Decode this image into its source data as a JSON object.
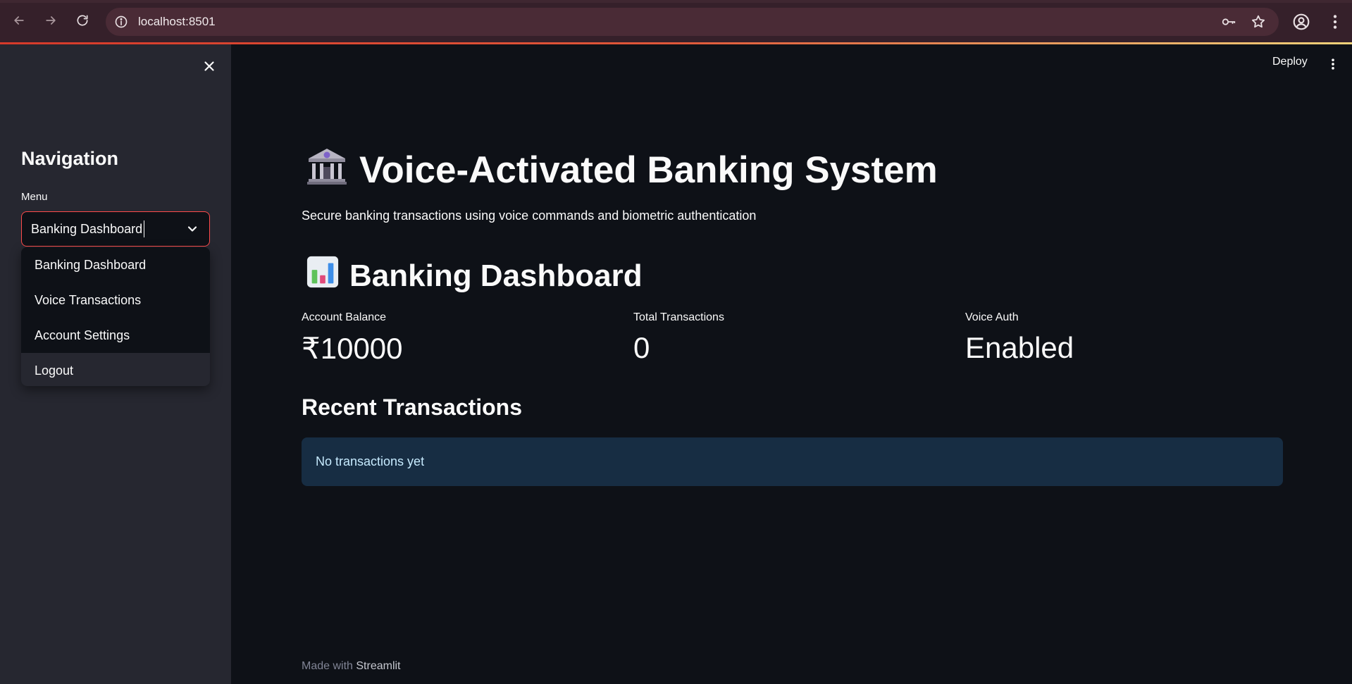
{
  "browser": {
    "url": "localhost:8501"
  },
  "sidebar": {
    "title": "Navigation",
    "menu_label": "Menu",
    "select_value": "Banking Dashboard",
    "options": [
      {
        "label": "Banking Dashboard"
      },
      {
        "label": "Voice Transactions"
      },
      {
        "label": "Account Settings"
      },
      {
        "label": "Logout"
      }
    ]
  },
  "header": {
    "deploy_label": "Deploy"
  },
  "main": {
    "title": "Voice-Activated Banking System",
    "title_icon": "bank-icon",
    "subtitle": "Secure banking transactions using voice commands and biometric authentication",
    "section_title": "Banking Dashboard",
    "section_icon": "bar-chart-icon",
    "metrics": [
      {
        "label": "Account Balance",
        "value": "₹10000"
      },
      {
        "label": "Total Transactions",
        "value": "0"
      },
      {
        "label": "Voice Auth",
        "value": "Enabled"
      }
    ],
    "recent_title": "Recent Transactions",
    "empty_message": "No transactions yet"
  },
  "footer": {
    "prefix": "Made with",
    "brand": "Streamlit"
  },
  "colors": {
    "background": "#0e1117",
    "sidebar": "#262730",
    "accent": "#ff4b4b",
    "info_bg": "#172d43",
    "info_text": "#c7ebff"
  }
}
